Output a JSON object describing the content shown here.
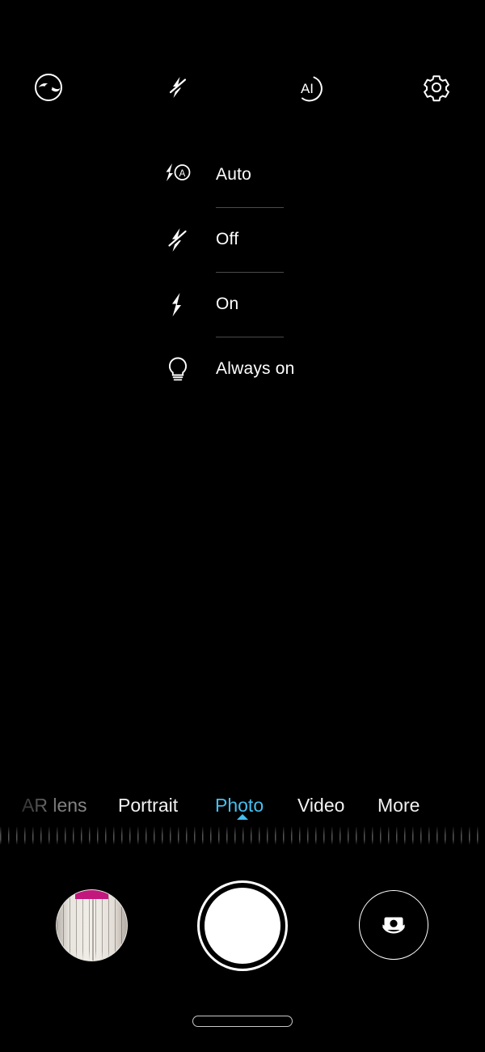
{
  "app": {
    "name": "Camera",
    "background_color": "#000000",
    "accent_color": "#45bff0"
  },
  "topbar": {
    "buttons": [
      {
        "name": "eye-mode-icon",
        "label": "Eye comfort / Moving picture"
      },
      {
        "name": "flash-off-icon",
        "label": "Flash"
      },
      {
        "name": "ai-icon",
        "label": "AI",
        "text": "AI"
      },
      {
        "name": "gear-icon",
        "label": "Settings"
      }
    ]
  },
  "flash_menu": {
    "visible": true,
    "selected": "Off",
    "options": [
      {
        "label": "Auto",
        "icon": "flash-auto-icon"
      },
      {
        "label": "Off",
        "icon": "flash-off-icon"
      },
      {
        "label": "On",
        "icon": "flash-on-icon"
      },
      {
        "label": "Always on",
        "icon": "torch-icon"
      }
    ]
  },
  "modebar": {
    "active": "Photo",
    "modes": [
      {
        "label": "AR lens",
        "state": "dim"
      },
      {
        "label": "Portrait",
        "state": "normal"
      },
      {
        "label": "Photo",
        "state": "active"
      },
      {
        "label": "Video",
        "state": "normal"
      },
      {
        "label": "More",
        "state": "normal"
      }
    ]
  },
  "zoom_ruler": {
    "visible": true
  },
  "bottombar": {
    "gallery_label": "Gallery thumbnail",
    "shutter_label": "Shutter",
    "flip_label": "Switch camera"
  },
  "system": {
    "home_indicator": "Home indicator"
  }
}
